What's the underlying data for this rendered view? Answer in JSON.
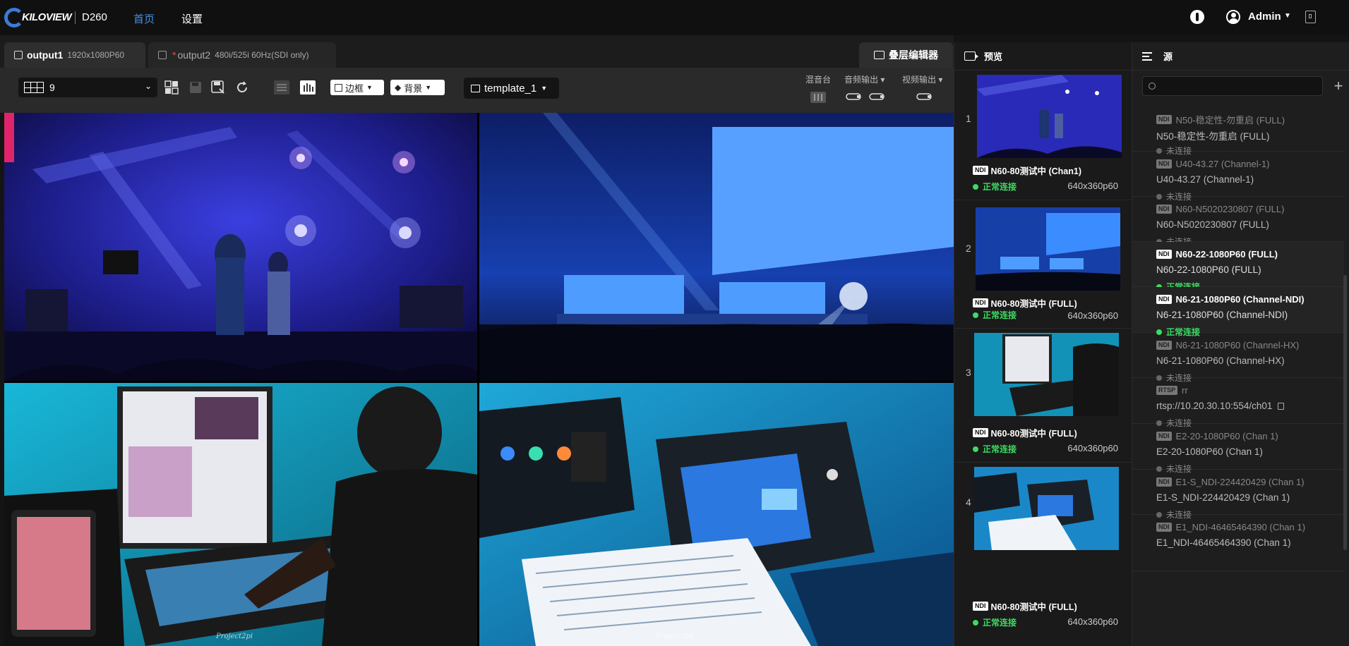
{
  "app": {
    "logo": "KILOVIEW",
    "model": "D260"
  },
  "nav": {
    "home": "首页",
    "settings": "设置"
  },
  "header": {
    "user": "Admin"
  },
  "tabs": [
    {
      "name": "output1",
      "sub": "1920x1080P60",
      "modified": ""
    },
    {
      "name": "output2",
      "sub": "480i/525i 60Hz(SDI only)",
      "modified": "*"
    }
  ],
  "overlay_editor": "叠层编辑器",
  "toolbar": {
    "layout_value": "9",
    "border_label": "边框",
    "background_label": "背景",
    "template_value": "template_1",
    "mixer_label": "混音台",
    "audio_out_label": "音频输出",
    "video_out_label": "视频输出"
  },
  "grid": {
    "watermark": "Project2pi"
  },
  "preview": {
    "title": "预览",
    "items": [
      {
        "num": "1",
        "name": "N60-80测试中 (Chan1)",
        "status": "正常连接",
        "res": "640x360p60"
      },
      {
        "num": "2",
        "name": "N60-80测试中 (FULL)",
        "status": "正常连接",
        "res": "640x360p60"
      },
      {
        "num": "3",
        "name": "N60-80测试中 (FULL)",
        "status": "正常连接",
        "res": "640x360p60"
      },
      {
        "num": "4",
        "name": "N60-80测试中 (FULL)",
        "status": "正常连接",
        "res": "640x360p60"
      }
    ]
  },
  "source": {
    "title": "源",
    "search_placeholder": "",
    "items": [
      {
        "tag": "NDI",
        "t1": "N50-稳定性-勿重启 (FULL)",
        "t2": "N50-稳定性-勿重启 (FULL)",
        "status": "未连接",
        "on": false
      },
      {
        "tag": "NDI",
        "t1": "U40-43.27 (Channel-1)",
        "t2": "U40-43.27 (Channel-1)",
        "status": "未连接",
        "on": false
      },
      {
        "tag": "NDI",
        "t1": "N60-N5020230807 (FULL)",
        "t2": "N60-N5020230807 (FULL)",
        "status": "未连接",
        "on": false
      },
      {
        "tag": "NDI",
        "t1": "N60-22-1080P60 (FULL)",
        "t2": "N60-22-1080P60 (FULL)",
        "status": "正常连接",
        "on": true
      },
      {
        "tag": "NDI",
        "t1": "N6-21-1080P60 (Channel-NDI)",
        "t2": "N6-21-1080P60 (Channel-NDI)",
        "status": "正常连接",
        "on": true
      },
      {
        "tag": "NDI",
        "t1": "N6-21-1080P60 (Channel-HX)",
        "t2": "N6-21-1080P60 (Channel-HX)",
        "status": "未连接",
        "on": false
      },
      {
        "tag": "RTSP",
        "t1": "rr",
        "t2": "rtsp://10.20.30.10:554/ch01",
        "status": "未连接",
        "on": false
      },
      {
        "tag": "NDI",
        "t1": "E2-20-1080P60 (Chan 1)",
        "t2": "E2-20-1080P60 (Chan 1)",
        "status": "未连接",
        "on": false
      },
      {
        "tag": "NDI",
        "t1": "E1-S_NDI-224420429 (Chan 1)",
        "t2": "E1-S_NDI-224420429 (Chan 1)",
        "status": "未连接",
        "on": false
      },
      {
        "tag": "NDI",
        "t1": "E1_NDI-46465464390 (Chan 1)",
        "t2": "E1_NDI-46465464390 (Chan 1)",
        "status": "",
        "on": false
      }
    ]
  }
}
